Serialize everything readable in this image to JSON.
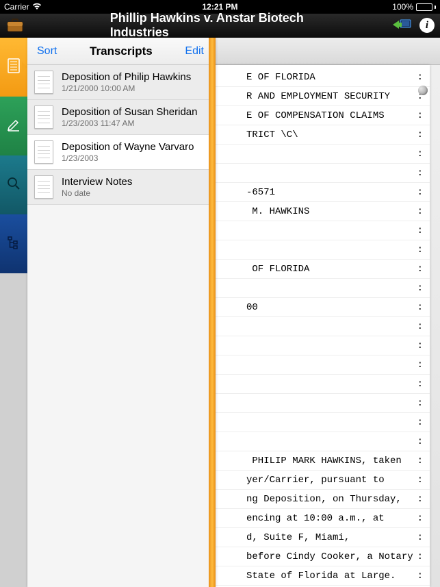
{
  "status": {
    "carrier": "Carrier",
    "time": "12:21 PM",
    "battery": "100%"
  },
  "header": {
    "title": "Phillip Hawkins v. Anstar Biotech Industries"
  },
  "panel": {
    "sort_label": "Sort",
    "edit_label": "Edit",
    "title": "Transcripts",
    "items": [
      {
        "title": "Deposition of Philip Hawkins",
        "subtitle": "1/21/2000 10:00 AM"
      },
      {
        "title": "Deposition of Susan Sheridan",
        "subtitle": "1/23/2003 11:47 AM"
      },
      {
        "title": "Deposition of Wayne Varvaro",
        "subtitle": "1/23/2003"
      },
      {
        "title": "Interview Notes",
        "subtitle": "No date"
      }
    ]
  },
  "document": {
    "lines": [
      "E OF FLORIDA",
      "R AND EMPLOYMENT SECURITY",
      "E OF COMPENSATION CLAIMS",
      "TRICT \\C\\",
      "",
      "",
      "-6571",
      " M. HAWKINS",
      "",
      "",
      " OF FLORIDA",
      "",
      "00",
      "",
      "",
      "",
      "",
      "",
      "",
      "",
      " PHILIP MARK HAWKINS, taken",
      "yer/Carrier, pursuant to",
      "ng Deposition, on Thursday,",
      "encing at 10:00 a.m., at",
      "d, Suite F, Miami,",
      "before Cindy Cooker, a Notary",
      "State of Florida at Large."
    ]
  }
}
